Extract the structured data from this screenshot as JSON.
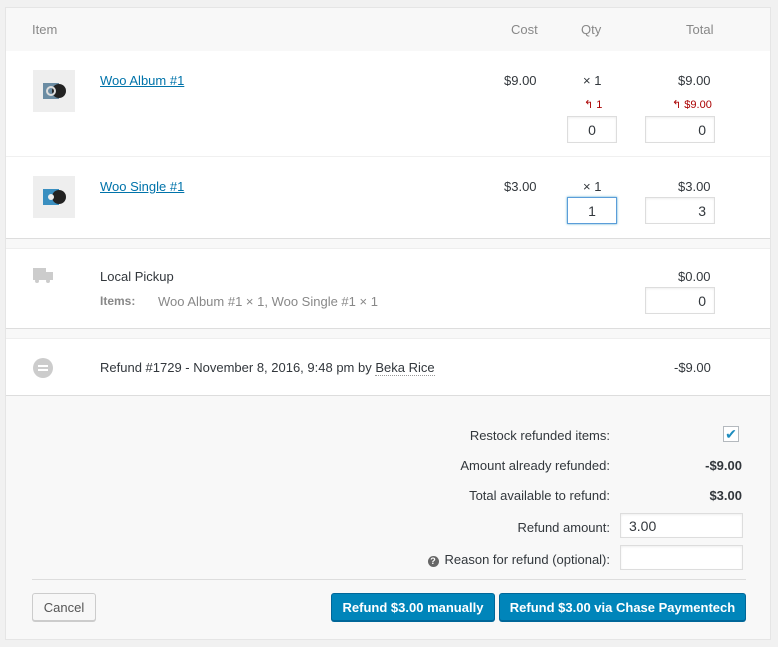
{
  "header": {
    "item": "Item",
    "cost": "Cost",
    "qty": "Qty",
    "total": "Total"
  },
  "items": [
    {
      "name": "Woo Album #1",
      "cost": "$9.00",
      "qty": "× 1",
      "total": "$9.00",
      "refunded_qty": "1",
      "refunded_total": "$9.00",
      "refund_qty_input": "0",
      "refund_total_input": "0"
    },
    {
      "name": "Woo Single #1",
      "cost": "$3.00",
      "qty": "× 1",
      "total": "$3.00",
      "refund_qty_input": "1",
      "refund_total_input": "3"
    }
  ],
  "shipping": {
    "method": "Local Pickup",
    "items_label": "Items:",
    "items_value": "Woo Album #1 × 1, Woo Single #1 × 1",
    "total": "$0.00",
    "refund_input": "0"
  },
  "refund": {
    "text": "Refund #1729 - November 8, 2016, 9:48 pm by ",
    "author": "Beka Rice",
    "amount": "-$9.00"
  },
  "summary": {
    "restock_label": "Restock refunded items:",
    "restock_checked": true,
    "already_label": "Amount already refunded:",
    "already_value": "-$9.00",
    "available_label": "Total available to refund:",
    "available_value": "$3.00",
    "amount_label": "Refund amount:",
    "amount_value": "3.00",
    "reason_label": "Reason for refund (optional):",
    "reason_value": ""
  },
  "buttons": {
    "cancel": "Cancel",
    "manual": "Refund $3.00 manually",
    "gateway": "Refund $3.00 via Chase Paymentech"
  },
  "colors": {
    "primary": "#0085ba",
    "link": "#0073aa",
    "refunded": "#aa0000"
  }
}
